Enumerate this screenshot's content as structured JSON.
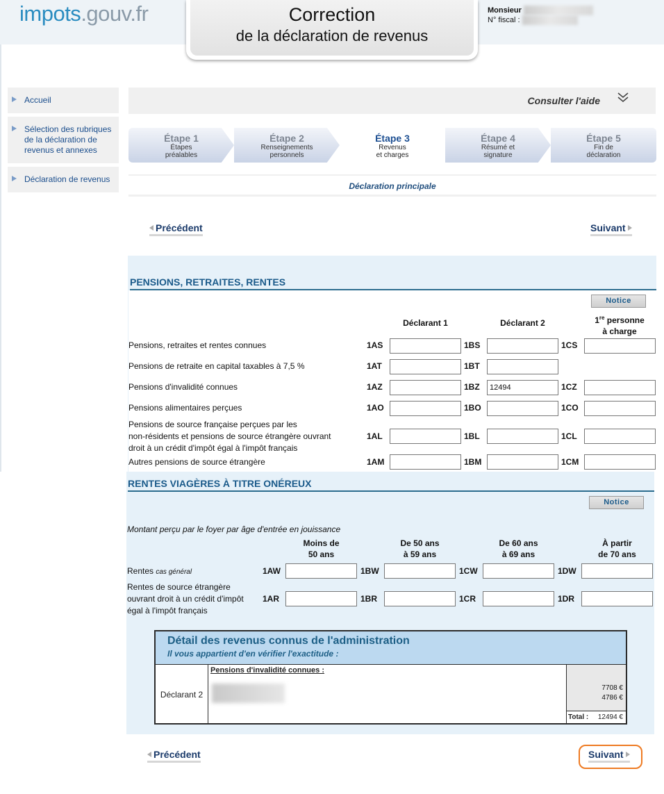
{
  "header": {
    "logo_main": "impots",
    "logo_dot": ".gouv.fr",
    "title_line1": "Correction",
    "title_line2": "de la déclaration de revenus",
    "user_label": "Monsieur",
    "fiscal_label": "N° fiscal :"
  },
  "sidebar": {
    "items": [
      {
        "label": "Accueil"
      },
      {
        "label": "Sélection des rubriques de la déclaration de revenus et annexes"
      },
      {
        "label": "Déclaration de revenus"
      }
    ]
  },
  "help": {
    "label": "Consulter l'aide",
    "icon": "double-chevron-down-icon"
  },
  "steps": [
    {
      "title": "Étape 1",
      "sub1": "Étapes",
      "sub2": "préalables"
    },
    {
      "title": "Étape 2",
      "sub1": "Renseignements",
      "sub2": "personnels"
    },
    {
      "title": "Étape 3",
      "sub1": "Revenus",
      "sub2": "et charges",
      "active": true
    },
    {
      "title": "Étape 4",
      "sub1": "Résumé et",
      "sub2": "signature"
    },
    {
      "title": "Étape 5",
      "sub1": "Fin de",
      "sub2": "déclaration"
    }
  ],
  "declaration_principale": "Déclaration principale",
  "nav": {
    "prev": "Précédent",
    "next": "Suivant"
  },
  "pensions": {
    "title": "PENSIONS, RETRAITES, RENTES",
    "notice": "Notice",
    "col1": "Déclarant 1",
    "col2": "Déclarant 2",
    "col3_a": "1",
    "col3_sup": "re",
    "col3_b": " personne",
    "col3_c": "à charge",
    "rows": [
      {
        "label": "Pensions, retraites et rentes connues",
        "codes": [
          "1AS",
          "1BS",
          "1CS"
        ],
        "values": [
          "",
          "",
          ""
        ]
      },
      {
        "label": "Pensions de retraite en capital taxables à 7,5 %",
        "codes": [
          "1AT",
          "1BT"
        ],
        "values": [
          "",
          ""
        ]
      },
      {
        "label": "Pensions d'invalidité connues",
        "codes": [
          "1AZ",
          "1BZ",
          "1CZ"
        ],
        "values": [
          "",
          "12494",
          ""
        ]
      },
      {
        "label": "Pensions alimentaires perçues",
        "codes": [
          "1AO",
          "1BO",
          "1CO"
        ],
        "values": [
          "",
          "",
          ""
        ]
      },
      {
        "label_l1": "Pensions de source française perçues par les",
        "label_l2": "non-résidents et pensions de source étrangère ouvrant",
        "label_l3": "droit à un crédit d'impôt égal à l'impôt français",
        "codes": [
          "1AL",
          "1BL",
          "1CL"
        ],
        "values": [
          "",
          "",
          ""
        ]
      },
      {
        "label": "Autres pensions de source étrangère",
        "codes": [
          "1AM",
          "1BM",
          "1CM"
        ],
        "values": [
          "",
          "",
          ""
        ]
      }
    ]
  },
  "rentes": {
    "title": "RENTES VIAGÈRES À TITRE ONÉREUX",
    "notice": "Notice",
    "subtitle": "Montant perçu par le foyer par âge d'entrée en jouissance",
    "cols": [
      {
        "l1": "Moins de",
        "l2": "50 ans"
      },
      {
        "l1": "De 50 ans",
        "l2": "à 59 ans"
      },
      {
        "l1": "De 60 ans",
        "l2": "à 69 ans"
      },
      {
        "l1": "À partir",
        "l2": "de 70 ans"
      }
    ],
    "row1_label": "Rentes",
    "row1_small": "cas général",
    "row1_codes": [
      "1AW",
      "1BW",
      "1CW",
      "1DW"
    ],
    "row2_l1": "Rentes de source étrangère",
    "row2_l2": "ouvrant droit à un crédit d'impôt",
    "row2_l3": "égal à l'impôt français",
    "row2_codes": [
      "1AR",
      "1BR",
      "1CR",
      "1DR"
    ]
  },
  "detail": {
    "title": "Détail des revenus connus de l'administration",
    "subtitle": "Il vous appartient d'en vérifier l'exactitude :",
    "declarant": "Déclarant 2",
    "category": "Pensions d'invalidité connues :",
    "amounts": [
      "7708  €",
      "4786  €"
    ],
    "total_label": "Total :",
    "total_value": "12494  €"
  }
}
